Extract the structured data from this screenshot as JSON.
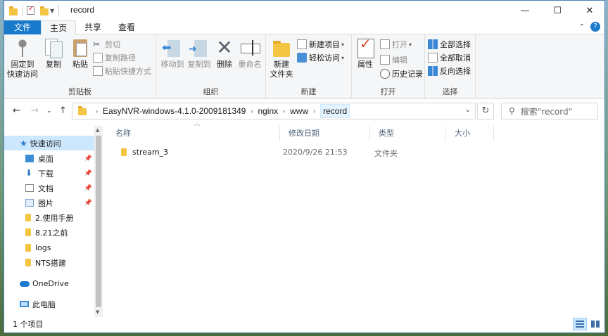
{
  "titlebar": {
    "title": "record",
    "controls": {
      "minimize": "—",
      "maximize": "☐",
      "close": "✕"
    }
  },
  "tabs": [
    "文件",
    "主页",
    "共享",
    "查看"
  ],
  "active_tab": "主页",
  "ribbon": {
    "clipboard": {
      "label": "剪贴板",
      "pin_line1": "固定到",
      "pin_line2": "快速访问",
      "copy": "复制",
      "paste": "粘贴",
      "cut": "剪切",
      "copy_path": "复制路径",
      "paste_shortcut": "粘贴快捷方式"
    },
    "organize": {
      "label": "组织",
      "move_to": "移动到",
      "copy_to": "复制到",
      "delete": "删除",
      "rename": "重命名"
    },
    "new": {
      "label": "新建",
      "new_folder_line1": "新建",
      "new_folder_line2": "文件夹",
      "new_item": "新建项目",
      "easy_access": "轻松访问"
    },
    "open": {
      "label": "打开",
      "properties": "属性",
      "open": "打开",
      "edit": "编辑",
      "history": "历史记录"
    },
    "select": {
      "label": "选择",
      "select_all": "全部选择",
      "select_none": "全部取消",
      "invert": "反向选择"
    }
  },
  "address": {
    "crumbs": [
      "EasyNVR-windows-4.1.0-2009181349",
      "nginx",
      "www",
      "record"
    ],
    "search_placeholder": "搜索\"record\""
  },
  "nav": {
    "quick_access": "快速访问",
    "items": [
      {
        "label": "桌面",
        "icon": "desktop-icon",
        "pinned": true
      },
      {
        "label": "下载",
        "icon": "download-icon",
        "pinned": true
      },
      {
        "label": "文档",
        "icon": "document-icon",
        "pinned": true
      },
      {
        "label": "图片",
        "icon": "picture-icon",
        "pinned": true
      },
      {
        "label": "2.使用手册",
        "icon": "folder-icon",
        "pinned": false
      },
      {
        "label": "8.21之前",
        "icon": "folder-icon",
        "pinned": false
      },
      {
        "label": "logs",
        "icon": "folder-icon",
        "pinned": false
      },
      {
        "label": "NTS搭建",
        "icon": "folder-icon",
        "pinned": false
      }
    ],
    "onedrive": "OneDrive",
    "this_pc": "此电脑"
  },
  "columns": {
    "name": "名称",
    "modified": "修改日期",
    "type": "类型",
    "size": "大小"
  },
  "files": [
    {
      "name": "stream_3",
      "modified": "2020/9/26 21:53",
      "type": "文件夹",
      "size": ""
    }
  ],
  "status": {
    "count": "1 个项目"
  }
}
